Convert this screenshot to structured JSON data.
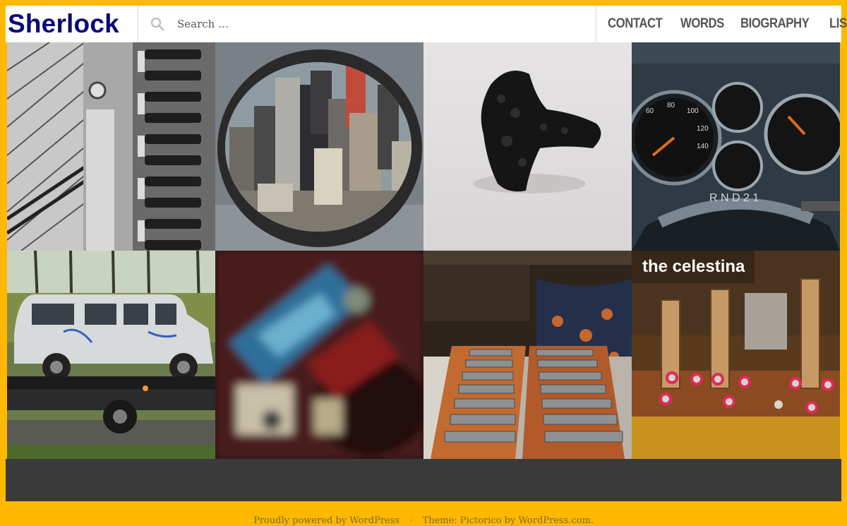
{
  "site": {
    "title": "Sherlock"
  },
  "search": {
    "placeholder": "Search …",
    "icon": "search-icon"
  },
  "nav": [
    {
      "label": "CONTACT"
    },
    {
      "label": "WORDS"
    },
    {
      "label": "BIOGRAPHY"
    },
    {
      "label": "LISTEN"
    }
  ],
  "gallery": {
    "tiles": [
      {
        "subject": "piano-dampers-bw"
      },
      {
        "subject": "city-porthole-view"
      },
      {
        "subject": "black-fungus-object"
      },
      {
        "subject": "car-dashboard-gauges"
      },
      {
        "subject": "graffiti-van-on-truck"
      },
      {
        "subject": "blurred-electronics"
      },
      {
        "subject": "metallophone-bars"
      },
      {
        "subject": "celestina-mechanism",
        "caption": "the celestina"
      }
    ]
  },
  "footer": {
    "powered": "Proudly powered by WordPress",
    "separator": "·",
    "theme": "Theme: Pictorico by WordPress.com."
  },
  "colors": {
    "frame": "#ffb800",
    "title": "#0a0a7a",
    "nav": "#555555",
    "footer_band": "#3a3a3a"
  }
}
